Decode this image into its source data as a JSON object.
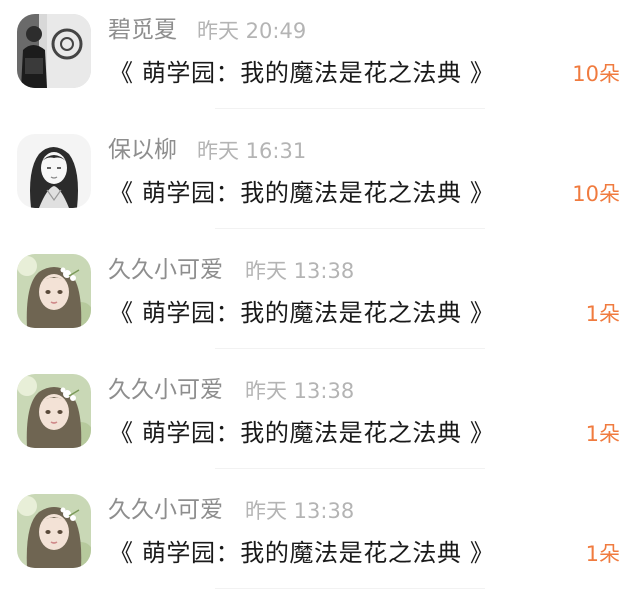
{
  "comments": [
    {
      "avatar_icon": "avatar-photo-bw-man",
      "name": "碧觅夏",
      "time": "昨天 20:49",
      "book": "《 萌学园：我的魔法是花之法典 》",
      "gift": "10朵"
    },
    {
      "avatar_icon": "avatar-illustration-bw-long-hair",
      "name": "保以柳",
      "time": "昨天 16:31",
      "book": "《 萌学园：我的魔法是花之法典 》",
      "gift": "10朵"
    },
    {
      "avatar_icon": "avatar-illustration-girl-flowers",
      "name": "久久小可爱",
      "time": "昨天 13:38",
      "book": "《 萌学园：我的魔法是花之法典 》",
      "gift": "1朵"
    },
    {
      "avatar_icon": "avatar-illustration-girl-flowers",
      "name": "久久小可爱",
      "time": "昨天 13:38",
      "book": "《 萌学园：我的魔法是花之法典 》",
      "gift": "1朵"
    },
    {
      "avatar_icon": "avatar-illustration-girl-flowers",
      "name": "久久小可爱",
      "time": "昨天 13:38",
      "book": "《 萌学园：我的魔法是花之法典 》",
      "gift": "1朵"
    }
  ],
  "colors": {
    "gift_accent": "#f07b3f",
    "name_gray": "#8e8e8e",
    "time_gray": "#b4b4b4",
    "title_text": "#1a1a1a"
  }
}
